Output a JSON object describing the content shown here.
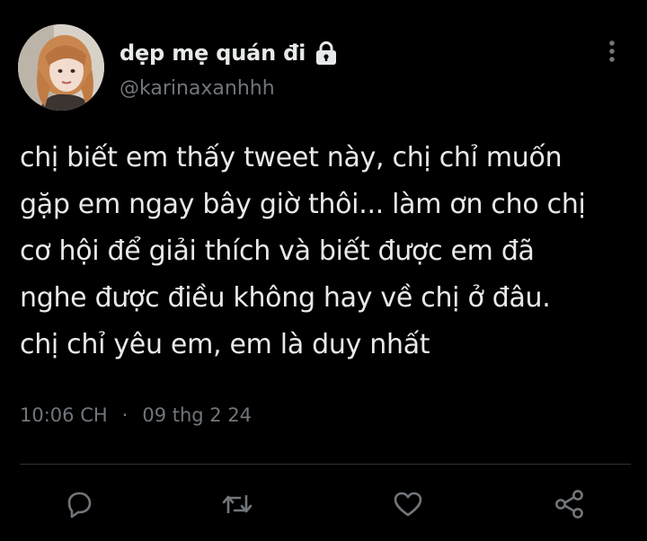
{
  "tweet": {
    "display_name": "dẹp mẹ quán đi",
    "username": "@karinaxanhhh",
    "text": "chị biết em thấy tweet này, chị chỉ muốn\ngặp em ngay bây giờ thôi... làm ơn cho chị\ncơ hội để giải thích và biết được em đã\nnghe được điều không hay về chị ở đâu.\nchị chỉ yêu em, em là duy nhất",
    "time": "10:06 CH",
    "separator": "·",
    "date": "09 thg 2 24"
  },
  "icons": {
    "lock": "lock-icon",
    "more": "more-vertical-icon",
    "reply": "reply-icon",
    "retweet": "retweet-icon",
    "like": "heart-icon",
    "share": "share-icon"
  },
  "colors": {
    "background": "#000000",
    "primary_text": "#e7e9ea",
    "secondary_text": "#71767b",
    "divider": "#2f3336"
  }
}
